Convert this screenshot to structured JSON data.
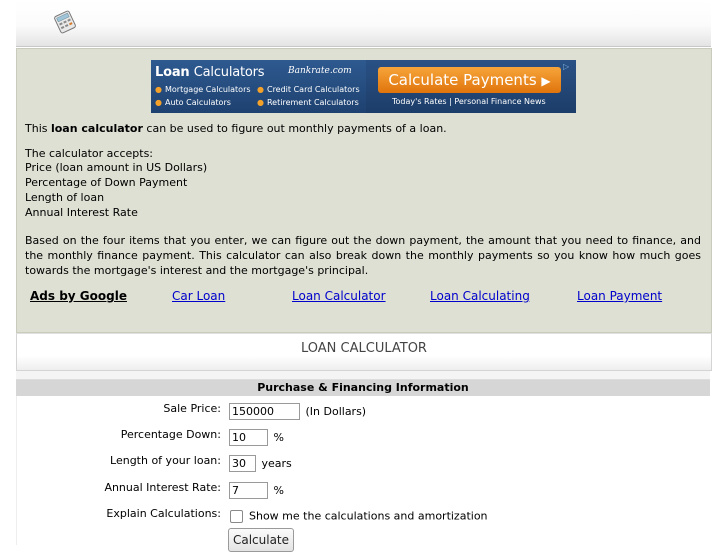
{
  "header": {
    "logo_icon": "calculator-icon"
  },
  "banner": {
    "brand_bold": "Loan",
    "brand_light": "Calculators",
    "bankrate": "Bankrate.com",
    "links": [
      "Mortgage Calculators",
      "Credit Card Calculators",
      "Auto Calculators",
      "Retirement Calculators"
    ],
    "cta": "Calculate Payments",
    "cta_arrow": "▶",
    "sub": "Today's Rates | Personal Finance News",
    "adchoice": "▷",
    "colors": {
      "bg": "#254a78",
      "cta": "#f29a2e",
      "bullet": "#f4a12a"
    }
  },
  "intro": {
    "line1_pre": "This ",
    "line1_bold": "loan calculator",
    "line1_post": " can be used to figure out monthly payments of a loan.",
    "accepts_title": "The calculator accepts:",
    "accepts": [
      "Price (loan amount in US Dollars)",
      "Percentage of Down Payment",
      "Length of loan",
      "Annual Interest Rate"
    ],
    "description": "Based on the four items that you enter, we can figure out the down payment, the amount that you need to finance, and the monthly finance payment. This calculator can also break down the monthly payments so you know how much goes towards the mortgage's interest and the mortgage's principal."
  },
  "adlinks": {
    "label": "Ads by Google",
    "links": [
      "Car Loan",
      "Loan Calculator",
      "Loan Calculating",
      "Loan Payment"
    ]
  },
  "section_title": "LOAN CALCULATOR",
  "form": {
    "heading": "Purchase & Financing Information",
    "sale_price": {
      "label": "Sale Price:",
      "value": "150000",
      "unit": "(In Dollars)"
    },
    "down": {
      "label": "Percentage Down:",
      "value": "10",
      "unit": "%"
    },
    "length": {
      "label": "Length of your loan:",
      "value": "30",
      "unit": "years"
    },
    "rate": {
      "label": "Annual Interest Rate:",
      "value": "7",
      "unit": "%"
    },
    "explain": {
      "label": "Explain Calculations:",
      "checkbox_label": "Show me the calculations and amortization",
      "checked": false
    },
    "submit": "Calculate"
  }
}
